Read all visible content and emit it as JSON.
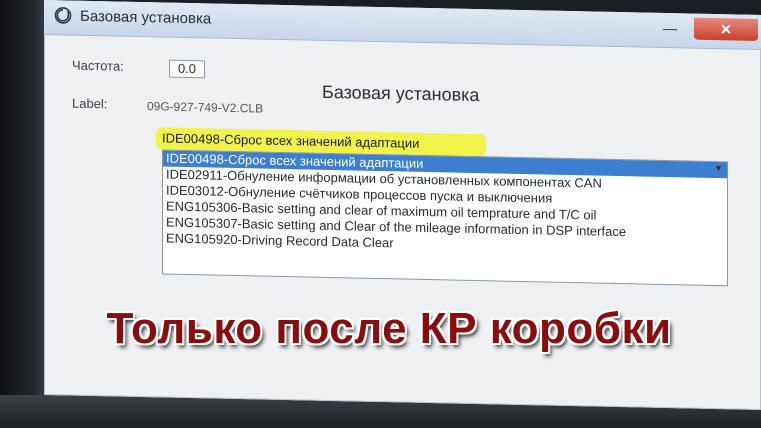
{
  "window": {
    "title": "Базовая установка",
    "minimize_symbol": "—",
    "close_symbol": "✕"
  },
  "form": {
    "frequency_label": "Частота:",
    "frequency_value": "0.0",
    "heading": "Базовая установка",
    "label_label": "Label:",
    "label_value": "09G-927-749-V2.CLB"
  },
  "dropdown": {
    "selected": "IDE00498-Сброс всех значений адаптации",
    "options": [
      "IDE00498-Сброс всех значений адаптации",
      "IDE02911-Обнуление информации об установленных компонентах CAN",
      "IDE03012-Обнуление счётчиков процессов пуска и выключения",
      "ENG105306-Basic setting and clear of maximum oil temprature and T/C oil",
      "ENG105307-Basic setting and Clear of the mileage information in DSP interface",
      "ENG105920-Driving Record Data Clear"
    ],
    "highlight_color": "#f1f24a",
    "selection_color": "#3c7fd1"
  },
  "overlay": {
    "caption": "Только после КР коробки",
    "caption_color": "#8b0c0c"
  },
  "icons": {
    "title": "power-refresh-icon",
    "dropdown": "chevron-down-icon"
  }
}
